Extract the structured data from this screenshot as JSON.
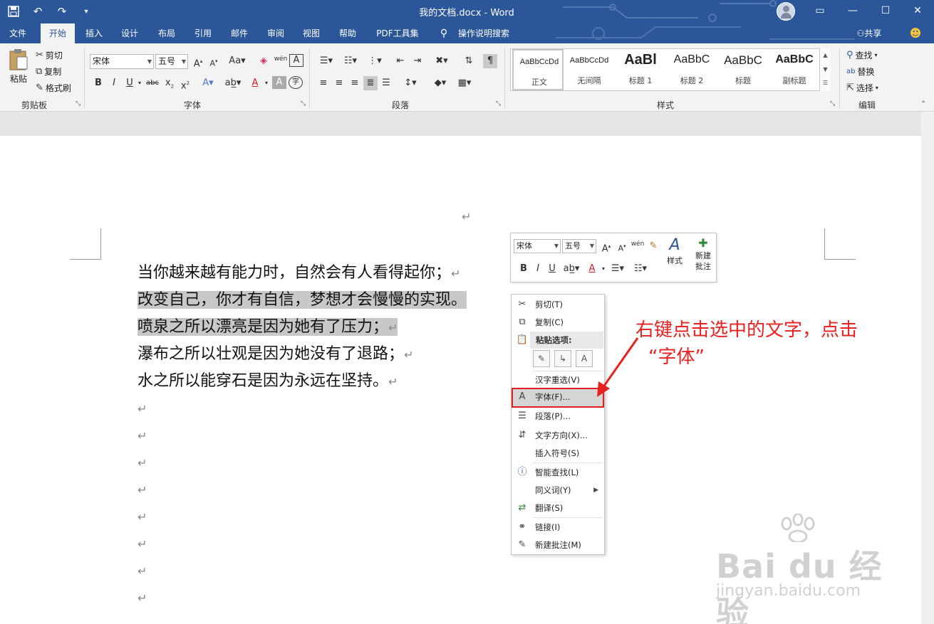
{
  "window": {
    "title": "我的文档.docx - Word"
  },
  "qat": {
    "save": "save-icon",
    "undo": "↶",
    "redo": "↷",
    "customize": "▾"
  },
  "window_controls": {
    "ribbon_opts": "▭",
    "minimize": "—",
    "maximize": "☐",
    "close": "✕"
  },
  "tabs": [
    {
      "label": "文件"
    },
    {
      "label": "开始"
    },
    {
      "label": "插入"
    },
    {
      "label": "设计"
    },
    {
      "label": "布局"
    },
    {
      "label": "引用"
    },
    {
      "label": "邮件"
    },
    {
      "label": "审阅"
    },
    {
      "label": "视图"
    },
    {
      "label": "帮助"
    },
    {
      "label": "PDF工具集"
    },
    {
      "label": "操作说明搜索"
    }
  ],
  "share": "共享",
  "ribbon": {
    "clipboard": {
      "paste": "粘贴",
      "cut": "剪切",
      "copy": "复制",
      "format_painter": "格式刷",
      "label": "剪贴板"
    },
    "font": {
      "name": "宋体",
      "size": "五号",
      "label": "字体"
    },
    "paragraph": {
      "label": "段落"
    },
    "styles": {
      "label": "样式",
      "items": [
        {
          "sample": "AaBbCcDd",
          "name": "正文"
        },
        {
          "sample": "AaBbCcDd",
          "name": "无间隔"
        },
        {
          "sample": "AaBl",
          "name": "标题 1"
        },
        {
          "sample": "AaBbC",
          "name": "标题 2"
        },
        {
          "sample": "AaBbC",
          "name": "标题"
        },
        {
          "sample": "AaBbC",
          "name": "副标题"
        }
      ]
    },
    "editing": {
      "find": "查找",
      "replace": "替换",
      "select": "选择",
      "label": "编辑"
    }
  },
  "document": {
    "lines": [
      "当你越来越有能力时，自然会有人看得起你；",
      "改变自己，你才有自信，梦想才会慢慢的实现。",
      "喷泉之所以漂亮是因为她有了压力；",
      "瀑布之所以壮观是因为她没有了退路；",
      "水之所以能穿石是因为永远在坚持。"
    ],
    "para_mark": "↵"
  },
  "mini_toolbar": {
    "font": "宋体",
    "size": "五号",
    "styles": "样式",
    "new_comment": "新建批注"
  },
  "context_menu": {
    "cut": "剪切(T)",
    "copy": "复制(C)",
    "paste_options": "粘贴选项:",
    "reconvert": "汉字重选(V)",
    "font": "字体(F)...",
    "paragraph": "段落(P)...",
    "text_direction": "文字方向(X)...",
    "insert_symbol": "插入符号(S)",
    "smart_lookup": "智能查找(L)",
    "synonyms": "同义词(Y)",
    "translate": "翻译(S)",
    "link": "链接(I)",
    "new_comment": "新建批注(M)"
  },
  "annotation": {
    "line1": "右键点击选中的文字，点击",
    "line2": "“字体”"
  },
  "watermark": {
    "brand": "Bai du 经验",
    "url": "jingyan.baidu.com"
  },
  "colors": {
    "accent": "#2b579a",
    "annotation": "#e82020",
    "selection": "#c8c8c8"
  }
}
